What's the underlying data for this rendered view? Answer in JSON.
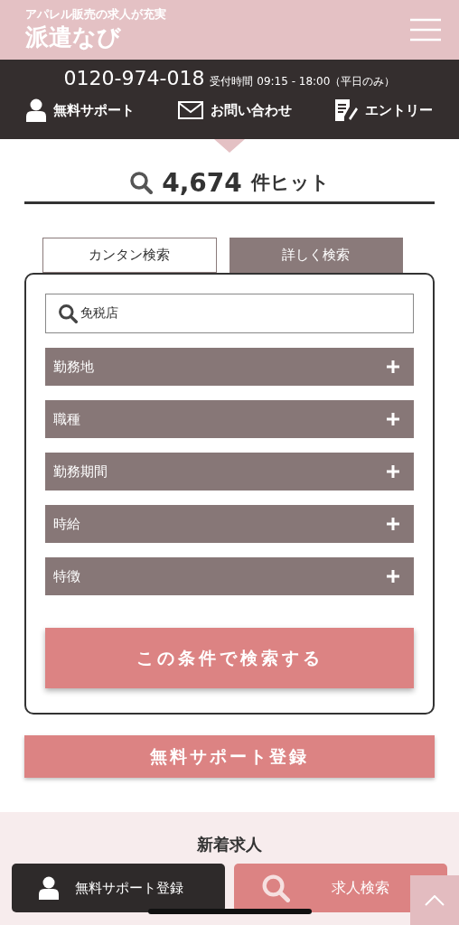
{
  "header": {
    "tagline": "アパレル販売の求人が充実",
    "logo": "派遣なび"
  },
  "contact": {
    "phone": "0120-974-018",
    "hours": "受付時間 09:15 - 18:00（平日のみ）"
  },
  "nav": [
    {
      "kind": "person",
      "label": "無料サポート"
    },
    {
      "kind": "mail",
      "label": "お問い合わせ"
    },
    {
      "kind": "entry",
      "label": "エントリー"
    }
  ],
  "hits": {
    "count": "4,674",
    "unit": "件ヒット"
  },
  "tabs": [
    {
      "label": "カンタン検索",
      "selected": true
    },
    {
      "label": "詳しく検索",
      "selected": false
    }
  ],
  "search": {
    "value": "免税店"
  },
  "filters": [
    {
      "label": "勤務地",
      "expanded": false
    },
    {
      "label": "職種",
      "expanded": false
    },
    {
      "label": "勤務期間",
      "expanded": false
    },
    {
      "label": "時給",
      "expanded": false
    },
    {
      "label": "特徴",
      "expanded": false
    }
  ],
  "search_button": "この条件で検索する",
  "support_button": "無料サポート登録",
  "section_title": "新着求人",
  "bottom_bar": [
    {
      "kind": "person",
      "label": "無料サポート登録"
    },
    {
      "kind": "search",
      "label": "求人検索"
    }
  ]
}
